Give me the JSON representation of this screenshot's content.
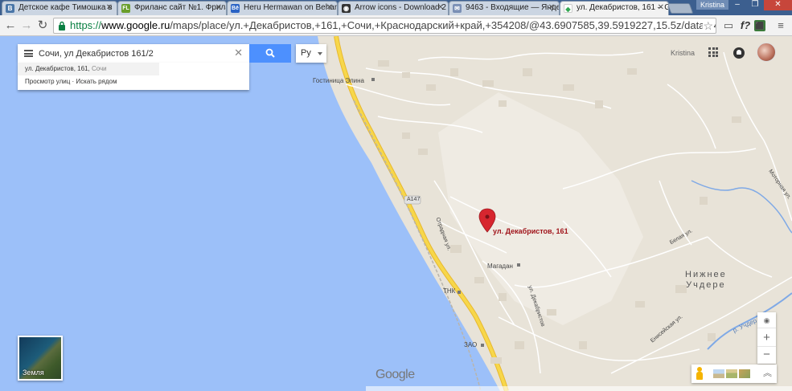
{
  "browser": {
    "tabs": [
      {
        "label": "Детское кафе Тимошка в",
        "favicon": "vk-icon",
        "color": "#4a76a8",
        "glyph": "B"
      },
      {
        "label": "Фриланс сайт №1. Фрила",
        "favicon": "fl-icon",
        "color": "#6a9e2b",
        "glyph": "FL"
      },
      {
        "label": "Heru Hermawan on Behan",
        "favicon": "behance-icon",
        "color": "#2b63c5",
        "glyph": "Bē"
      },
      {
        "label": "Arrow icons - Download 2",
        "favicon": "eye-icon",
        "color": "#333333",
        "glyph": "◉"
      },
      {
        "label": "9463 - Входящие — Янде",
        "favicon": "mail-icon",
        "color": "#7a8fb5",
        "glyph": "✉"
      },
      {
        "label": "ул. Декабристов, 161 – G",
        "favicon": "maps-icon",
        "color": "#34a853",
        "glyph": "◆"
      }
    ],
    "user_chip": "Kristina",
    "url_protocol": "https://",
    "url_host": "www.google.ru",
    "url_path": "/maps/place/ул.+Декабристов,+161,+Сочи,+Краснодарский+край,+354208/@43.6907585,39.5919227,15.5z/data=!4m2!3m1!1s0x",
    "ext_f": "f?"
  },
  "search": {
    "value": "Сочи, ул Декабристов 161/2",
    "language": "Ру",
    "suggestion_main": "ул. Декабристов, 161,",
    "suggestion_sub": "Сочи",
    "links": "Просмотр улиц · Искать рядом"
  },
  "account": {
    "name": "Kristina"
  },
  "map": {
    "labels": {
      "hotel": "Гостиница Элина",
      "road_badge": "A147",
      "street_otradnaya": "Отрадная ул.",
      "marker": "ул. Декабристов, 161",
      "magadan": "Магадан",
      "tnk": "ТНК",
      "street_dekabristov": "ул. Декабристов",
      "zao": "ЗАО",
      "belaya": "Белая ул.",
      "eniseyskaya": "Енисейская ул.",
      "motornaya": "Моторная ул.",
      "river": "р. Учдер",
      "village": "Нижнее\nУчдере"
    },
    "colors": {
      "sea": "#9cc0f9",
      "land": "#e8e3d8",
      "highway": "#f7d74a",
      "marker": "#d7262f",
      "river": "#7fa9e6"
    }
  },
  "controls": {
    "earth_label": "Земля",
    "zoom_in": "+",
    "zoom_out": "−",
    "google": "Google"
  }
}
